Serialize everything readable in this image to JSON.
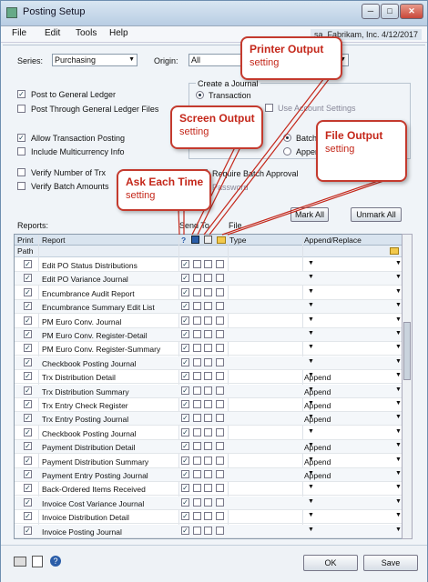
{
  "window": {
    "title": "Posting Setup",
    "minimize": "─",
    "maximize": "□",
    "close": "✕"
  },
  "menubar": {
    "items": [
      "File",
      "Edit",
      "Tools",
      "Help"
    ],
    "company": "sa, Fabrikam, Inc.  4/12/2017"
  },
  "header": {
    "series_label": "Series:",
    "series_value": "Purchasing",
    "origin_label": "Origin:",
    "origin_value": "All"
  },
  "options": {
    "post_gl": {
      "label": "Post to General Ledger",
      "checked": true
    },
    "post_through": {
      "label": "Post Through General Ledger Files",
      "checked": false
    },
    "allow_trx": {
      "label": "Allow Transaction Posting",
      "checked": true
    },
    "multicurrency": {
      "label": "Include Multicurrency Info",
      "checked": false
    },
    "verify_trx": {
      "label": "Verify Number of Trx",
      "checked": false
    },
    "verify_batch": {
      "label": "Verify Batch Amounts",
      "checked": false
    }
  },
  "journal_group": {
    "title": "Create a Journal",
    "transaction": "Transaction",
    "use_account": "Use Account Settings",
    "batch": "Batch",
    "append": "Append",
    "require_approval": "Require Batch Approval",
    "password": "Password"
  },
  "buttons": {
    "mark_all": "Mark All",
    "unmark_all": "Unmark All",
    "ok": "OK",
    "save": "Save"
  },
  "reports_label": "Reports:",
  "send_to_label": "Send To",
  "file_label": "File",
  "grid": {
    "headers": {
      "print": "Print",
      "report": "Report",
      "ask": "?",
      "type": "Type",
      "append": "Append/Replace"
    },
    "path_label": "Path",
    "rows": [
      {
        "name": "Edit PO Status Distributions",
        "append": ""
      },
      {
        "name": "Edit PO Variance Journal",
        "append": ""
      },
      {
        "name": "Encumbrance Audit Report",
        "append": ""
      },
      {
        "name": "Encumbrance Summary Edit List",
        "append": ""
      },
      {
        "name": "PM Euro Conv. Journal",
        "append": ""
      },
      {
        "name": "PM Euro Conv. Register-Detail",
        "append": ""
      },
      {
        "name": "PM Euro Conv. Register-Summary",
        "append": ""
      },
      {
        "name": "Checkbook Posting Journal",
        "append": ""
      },
      {
        "name": "Trx Distribution Detail",
        "append": "Append"
      },
      {
        "name": "Trx Distribution Summary",
        "append": "Append"
      },
      {
        "name": "Trx Entry Check Register",
        "append": "Append"
      },
      {
        "name": "Trx Entry Posting Journal",
        "append": "Append"
      },
      {
        "name": "Checkbook Posting Journal",
        "append": ""
      },
      {
        "name": "Payment Distribution Detail",
        "append": "Append"
      },
      {
        "name": "Payment Distribution Summary",
        "append": "Append"
      },
      {
        "name": "Payment Entry Posting Journal",
        "append": "Append"
      },
      {
        "name": "Back-Ordered Items Received",
        "append": ""
      },
      {
        "name": "Invoice Cost Variance Journal",
        "append": ""
      },
      {
        "name": "Invoice Distribution Detail",
        "append": ""
      },
      {
        "name": "Invoice Posting Journal",
        "append": ""
      }
    ]
  },
  "callouts": {
    "printer": {
      "title": "Printer Output",
      "sub": "setting"
    },
    "screen": {
      "title": "Screen Output",
      "sub": "setting"
    },
    "file": {
      "title": "File Output",
      "sub": "setting"
    },
    "ask": {
      "title": "Ask Each Time",
      "sub": "setting"
    }
  },
  "colors": {
    "callout_red": "#c4271a",
    "accent_blue": "#2a5da8"
  }
}
